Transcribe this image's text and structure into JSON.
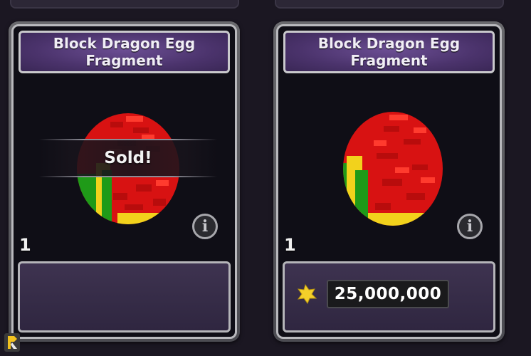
{
  "cards": [
    {
      "title": "Block Dragon Egg\nFragment",
      "quantity": "1",
      "status_overlay": "Sold!",
      "price": null
    },
    {
      "title": "Block Dragon Egg\nFragment",
      "quantity": "1",
      "status_overlay": null,
      "price": "25,000,000"
    }
  ],
  "icons": {
    "info": "info-icon",
    "currency": "gold-cubit-icon",
    "logo": "game-logo-icon"
  },
  "colors": {
    "title_purple": "#4b336c",
    "egg_red": "#e01414",
    "egg_green": "#1f9a18",
    "egg_yellow": "#f2d21c",
    "currency_gold": "#f3cf2a"
  }
}
